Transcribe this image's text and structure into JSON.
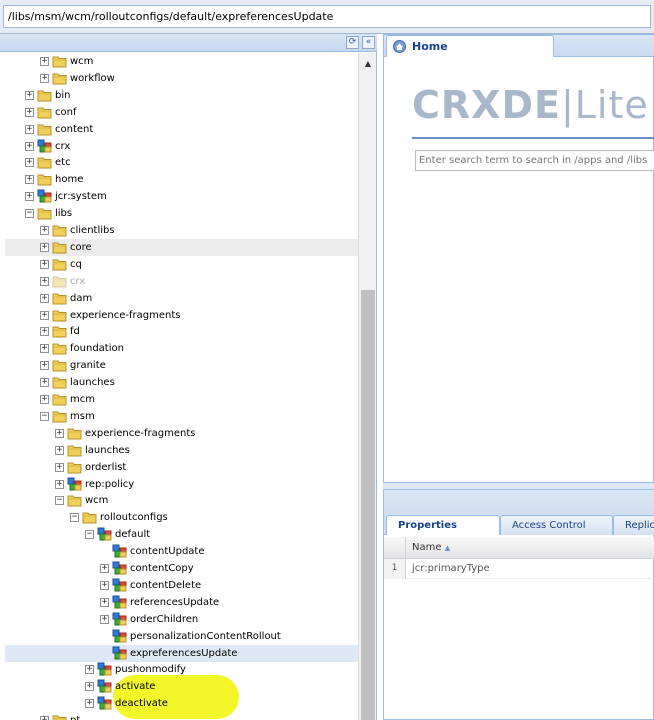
{
  "path": "/libs/msm/wcm/rolloutconfigs/default/expreferencesUpdate",
  "tree": [
    {
      "label": "wcm",
      "depth": 2,
      "type": "folder",
      "toggle": "+"
    },
    {
      "label": "workflow",
      "depth": 2,
      "type": "folder",
      "toggle": "+"
    },
    {
      "label": "bin",
      "depth": 1,
      "type": "folder",
      "toggle": "+"
    },
    {
      "label": "conf",
      "depth": 1,
      "type": "folder",
      "toggle": "+"
    },
    {
      "label": "content",
      "depth": 1,
      "type": "folder",
      "toggle": "+"
    },
    {
      "label": "crx",
      "depth": 1,
      "type": "node",
      "toggle": "+"
    },
    {
      "label": "etc",
      "depth": 1,
      "type": "folder",
      "toggle": "+"
    },
    {
      "label": "home",
      "depth": 1,
      "type": "folder",
      "toggle": "+"
    },
    {
      "label": "jcr:system",
      "depth": 1,
      "type": "node",
      "toggle": "+"
    },
    {
      "label": "libs",
      "depth": 1,
      "type": "folder",
      "toggle": "-"
    },
    {
      "label": "clientlibs",
      "depth": 2,
      "type": "folder",
      "toggle": "+"
    },
    {
      "label": "core",
      "depth": 2,
      "type": "folder",
      "toggle": "+",
      "hover": true
    },
    {
      "label": "cq",
      "depth": 2,
      "type": "folder",
      "toggle": "+"
    },
    {
      "label": "crx",
      "depth": 2,
      "type": "folder",
      "toggle": "+",
      "faded": true
    },
    {
      "label": "dam",
      "depth": 2,
      "type": "folder",
      "toggle": "+"
    },
    {
      "label": "experience-fragments",
      "depth": 2,
      "type": "folder",
      "toggle": "+"
    },
    {
      "label": "fd",
      "depth": 2,
      "type": "folder",
      "toggle": "+"
    },
    {
      "label": "foundation",
      "depth": 2,
      "type": "folder",
      "toggle": "+"
    },
    {
      "label": "granite",
      "depth": 2,
      "type": "folder",
      "toggle": "+"
    },
    {
      "label": "launches",
      "depth": 2,
      "type": "folder",
      "toggle": "+"
    },
    {
      "label": "mcm",
      "depth": 2,
      "type": "folder",
      "toggle": "+"
    },
    {
      "label": "msm",
      "depth": 2,
      "type": "folder",
      "toggle": "-"
    },
    {
      "label": "experience-fragments",
      "depth": 3,
      "type": "folder",
      "toggle": "+"
    },
    {
      "label": "launches",
      "depth": 3,
      "type": "folder",
      "toggle": "+"
    },
    {
      "label": "orderlist",
      "depth": 3,
      "type": "folder",
      "toggle": "+"
    },
    {
      "label": "rep:policy",
      "depth": 3,
      "type": "node",
      "toggle": "+"
    },
    {
      "label": "wcm",
      "depth": 3,
      "type": "folder",
      "toggle": "-"
    },
    {
      "label": "rolloutconfigs",
      "depth": 4,
      "type": "folder",
      "toggle": "-"
    },
    {
      "label": "default",
      "depth": 5,
      "type": "node",
      "toggle": "-"
    },
    {
      "label": "contentUpdate",
      "depth": 6,
      "type": "node",
      "toggle": ""
    },
    {
      "label": "contentCopy",
      "depth": 6,
      "type": "node",
      "toggle": "+"
    },
    {
      "label": "contentDelete",
      "depth": 6,
      "type": "node",
      "toggle": "+"
    },
    {
      "label": "referencesUpdate",
      "depth": 6,
      "type": "node",
      "toggle": "+"
    },
    {
      "label": "orderChildren",
      "depth": 6,
      "type": "node",
      "toggle": "+"
    },
    {
      "label": "personalizationContentRollout",
      "depth": 6,
      "type": "node",
      "toggle": ""
    },
    {
      "label": "expreferencesUpdate",
      "depth": 6,
      "type": "node",
      "toggle": "",
      "selected": true
    },
    {
      "label": "pushonmodify",
      "depth": 5,
      "type": "node",
      "toggle": "+"
    },
    {
      "label": "activate",
      "depth": 5,
      "type": "node",
      "toggle": "+"
    },
    {
      "label": "deactivate",
      "depth": 5,
      "type": "node",
      "toggle": "+"
    },
    {
      "label": "pt",
      "depth": 2,
      "type": "folder",
      "toggle": "+"
    }
  ],
  "home_tab": {
    "label": "Home",
    "icon": "home-icon"
  },
  "logo": {
    "crx": "CRXDE",
    "sep": "|",
    "lite": "Lite"
  },
  "search": {
    "placeholder": "Enter search term to search in /apps and /libs"
  },
  "bottom_tabs": [
    "Properties",
    "Access Control",
    "Replication"
  ],
  "properties": {
    "column_name": "Name",
    "sort_indicator": "▲",
    "rows": [
      {
        "num": "1",
        "name": "jcr:primaryType"
      }
    ]
  },
  "header_buttons": {
    "collapse": "«",
    "refresh": "⟳"
  },
  "colors": {
    "folder": "#e9c45a",
    "accent": "#15428b",
    "highlight": "#f2f51e"
  }
}
